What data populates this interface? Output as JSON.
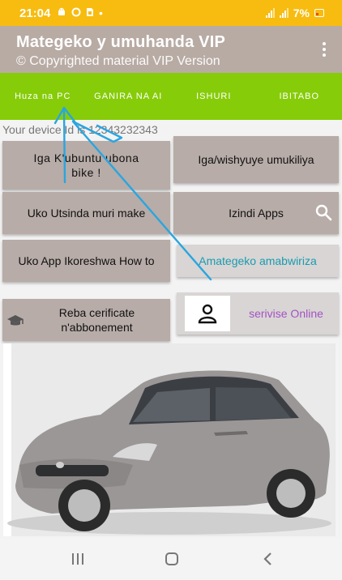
{
  "status": {
    "time": "21:04",
    "battery": "7%",
    "dot": "•"
  },
  "appbar": {
    "title": "Mategeko y umuhanda VIP",
    "subtitle": "© Copyrighted material VIP Version",
    "menu_icon": "more-vert-icon"
  },
  "tabs": [
    {
      "label": "Huza na PC"
    },
    {
      "label": "GANIRA NA AI"
    },
    {
      "label": "ISHURI"
    },
    {
      "label": "IBITABO"
    }
  ],
  "device": {
    "text": "Your device Id is 12343232343"
  },
  "buttons": {
    "learn": "Iga K'ubuntu ubona bike !",
    "wishyuye": "Iga/wishyuye  umukiliya",
    "utsinda": "Uko Utsinda muri make",
    "apps": "Izindi Apps",
    "howto": "Uko App Ikoreshwa How to",
    "amategeko": "Amategeko  amabwiriza",
    "certificate": "Reba cerificate n'abbonement",
    "online": "serivise Online"
  },
  "colors": {
    "status_bar": "#f7bc0f",
    "app_bar": "#b8aba4",
    "tab_bar": "#86cc09",
    "button": "#b7aca7",
    "teal_text": "#1a9bb0",
    "purple_text": "#a352c4",
    "annotation_arrow": "#2aa5e0"
  },
  "icons": {
    "search": "search-icon",
    "certificate": "graduation-cap-icon",
    "online": "person-icon",
    "nav_recent": "recent-apps-icon",
    "nav_home": "home-icon",
    "nav_back": "back-icon"
  },
  "image": {
    "subject": "car"
  }
}
